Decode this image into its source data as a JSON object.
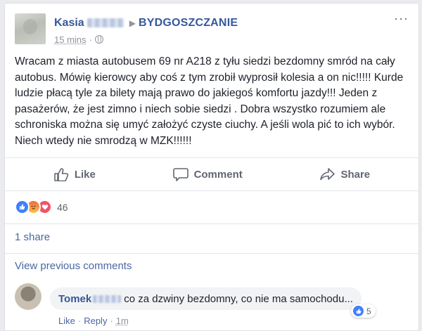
{
  "post": {
    "author": "Kasia",
    "group": "BYDGOSZCZANIE",
    "time": "15 mins",
    "text": "Wracam z miasta autobusem 69 nr A218 z tyłu siedzi bezdomny smród na cały autobus. Mówię kierowcy aby coś z tym zrobił wyprosił kolesia a on nic!!!!! Kurde ludzie płacą tyle za bilety mają prawo do jakiegoś komfortu jazdy!!! Jeden z pasażerów, że jest zimno i niech sobie siedzi . Dobra wszystko rozumiem ale schroniska można się umyć założyć czyste ciuchy. A jeśli wola pić to ich wybór. Niech wtedy nie smrodzą w MZK!!!!!!",
    "privacy_icon": "globe-icon",
    "more_label": "···"
  },
  "actions": {
    "like": "Like",
    "comment": "Comment",
    "share": "Share"
  },
  "reactions": {
    "types": [
      "like",
      "angry",
      "love"
    ],
    "count": "46"
  },
  "shares_label": "1 share",
  "view_previous_comments": "View previous comments",
  "comment": {
    "author": "Tomek",
    "text": "co za dzwiny bezdomny, co nie ma samochodu...",
    "reaction_count": "5",
    "like_label": "Like",
    "reply_label": "Reply",
    "time": "1m"
  },
  "colors": {
    "link": "#365899",
    "muted": "#90949c",
    "like_blue": "#4080ff",
    "love_red": "#f25268"
  }
}
